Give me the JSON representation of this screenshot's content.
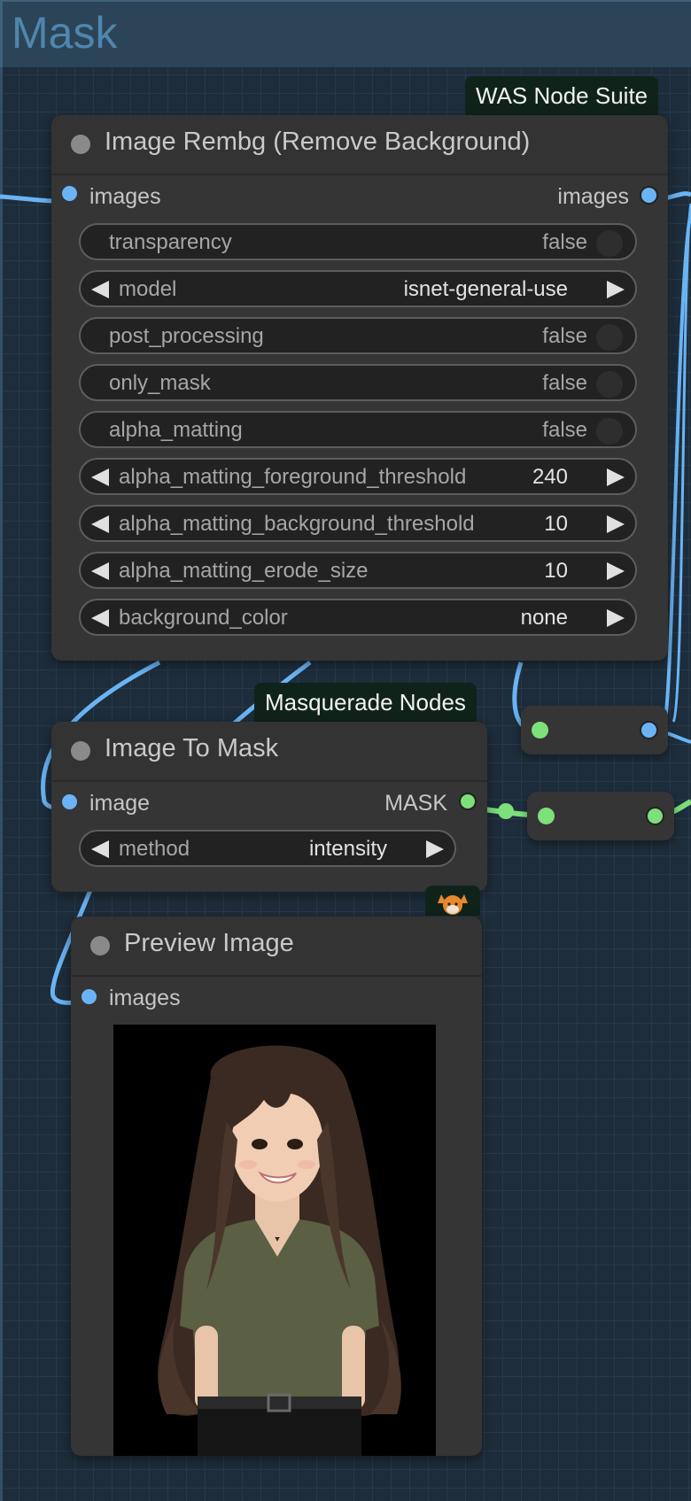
{
  "group": {
    "title": "Mask"
  },
  "colors": {
    "image_link": "#6ab4f5",
    "mask_link": "#7de07a",
    "node_bg": "#353535",
    "badge_bg": "#10231a"
  },
  "nodes": {
    "rembg": {
      "badge": "WAS Node Suite",
      "title": "Image Rembg (Remove Background)",
      "input_label": "images",
      "output_label": "images",
      "widgets": {
        "transparency": {
          "label": "transparency",
          "value": "false"
        },
        "model": {
          "label": "model",
          "value": "isnet-general-use"
        },
        "post_processing": {
          "label": "post_processing",
          "value": "false"
        },
        "only_mask": {
          "label": "only_mask",
          "value": "false"
        },
        "alpha_matting": {
          "label": "alpha_matting",
          "value": "false"
        },
        "fg_threshold": {
          "label": "alpha_matting_foreground_threshold",
          "value": "240"
        },
        "bg_threshold": {
          "label": "alpha_matting_background_threshold",
          "value": "10"
        },
        "erode_size": {
          "label": "alpha_matting_erode_size",
          "value": "10"
        },
        "background_color": {
          "label": "background_color",
          "value": "none"
        }
      }
    },
    "to_mask": {
      "badge": "Masquerade Nodes",
      "title": "Image To Mask",
      "input_label": "image",
      "output_label": "MASK",
      "widgets": {
        "method": {
          "label": "method",
          "value": "intensity"
        }
      }
    },
    "preview": {
      "badge_icon": "fox-icon",
      "title": "Preview Image",
      "input_label": "images"
    }
  }
}
